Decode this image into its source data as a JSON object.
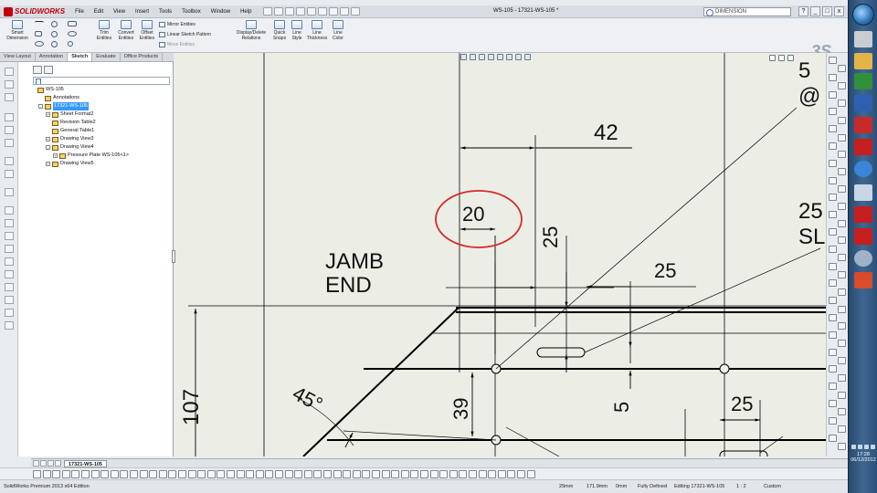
{
  "app": {
    "name": "SOLIDWORKS",
    "window_title": "WS-105 - 17321-WS-105 *",
    "search_placeholder": "DIMENSION"
  },
  "menu": [
    "File",
    "Edit",
    "View",
    "Insert",
    "Tools",
    "Toolbox",
    "Window",
    "Help"
  ],
  "window_controls": [
    "_",
    "□",
    "x"
  ],
  "ribbon": {
    "smart_dimension": "Smart Dimension",
    "trim_entities": "Trim Entities",
    "convert_entities": "Convert Entities",
    "offset_entities": "Offset Entities",
    "mirror_entities": "Mirror Entities",
    "linear_sketch_pattern": "Linear Sketch Pattern",
    "move_entities": "Move Entities",
    "display_delete_relations": "Display/Delete Relations",
    "quick_snaps": "Quick Snaps",
    "line_style": "Line Style",
    "line_thickness": "Line Thickness",
    "line_color": "Line Color"
  },
  "tabs": [
    "View Layout",
    "Annotation",
    "Sketch",
    "Evaluate",
    "Office Products"
  ],
  "active_tab": "Sketch",
  "tree": [
    {
      "label": "WS-105",
      "indent": 0,
      "toggle": ""
    },
    {
      "label": "Annotations",
      "indent": 1,
      "toggle": ""
    },
    {
      "label": "17321-WS-105",
      "indent": 1,
      "toggle": "-",
      "selected": true
    },
    {
      "label": "Sheet Format2",
      "indent": 2,
      "toggle": "+"
    },
    {
      "label": "Revision Table2",
      "indent": 2,
      "toggle": ""
    },
    {
      "label": "General Table1",
      "indent": 2,
      "toggle": ""
    },
    {
      "label": "Drawing View3",
      "indent": 2,
      "toggle": "+"
    },
    {
      "label": "Drawing View4",
      "indent": 2,
      "toggle": "-"
    },
    {
      "label": "Pressure Plate WS-105<1>",
      "indent": 3,
      "toggle": "+"
    },
    {
      "label": "Drawing View5",
      "indent": 2,
      "toggle": "+"
    }
  ],
  "drawing": {
    "label_line1": "JAMB",
    "label_line2": "END",
    "dim_42": "42",
    "dim_20": "20",
    "dim_25_vertical": "25",
    "dim_25_horizontal": "25",
    "dim_5_vertical": "5",
    "dim_39": "39",
    "dim_107": "107",
    "dim_45deg": "45°",
    "dim_25_lower": "25",
    "note_5": "5",
    "note_at": "@",
    "note_25": "25",
    "note_sl": "SL",
    "annotation_color": "#d42a2a"
  },
  "sheet_tab": "17321-WS-105",
  "status": {
    "edition": "SolidWorks Premium 2013 x64 Edition",
    "x": "29mm",
    "y": "171.9mm",
    "z": "0mm",
    "state": "Fully Defined",
    "editing": "Editing 17321-WS-105",
    "scale": "1 : 2",
    "units": "Custom"
  },
  "clock": {
    "time": "17:28",
    "date": "06/12/2012"
  }
}
